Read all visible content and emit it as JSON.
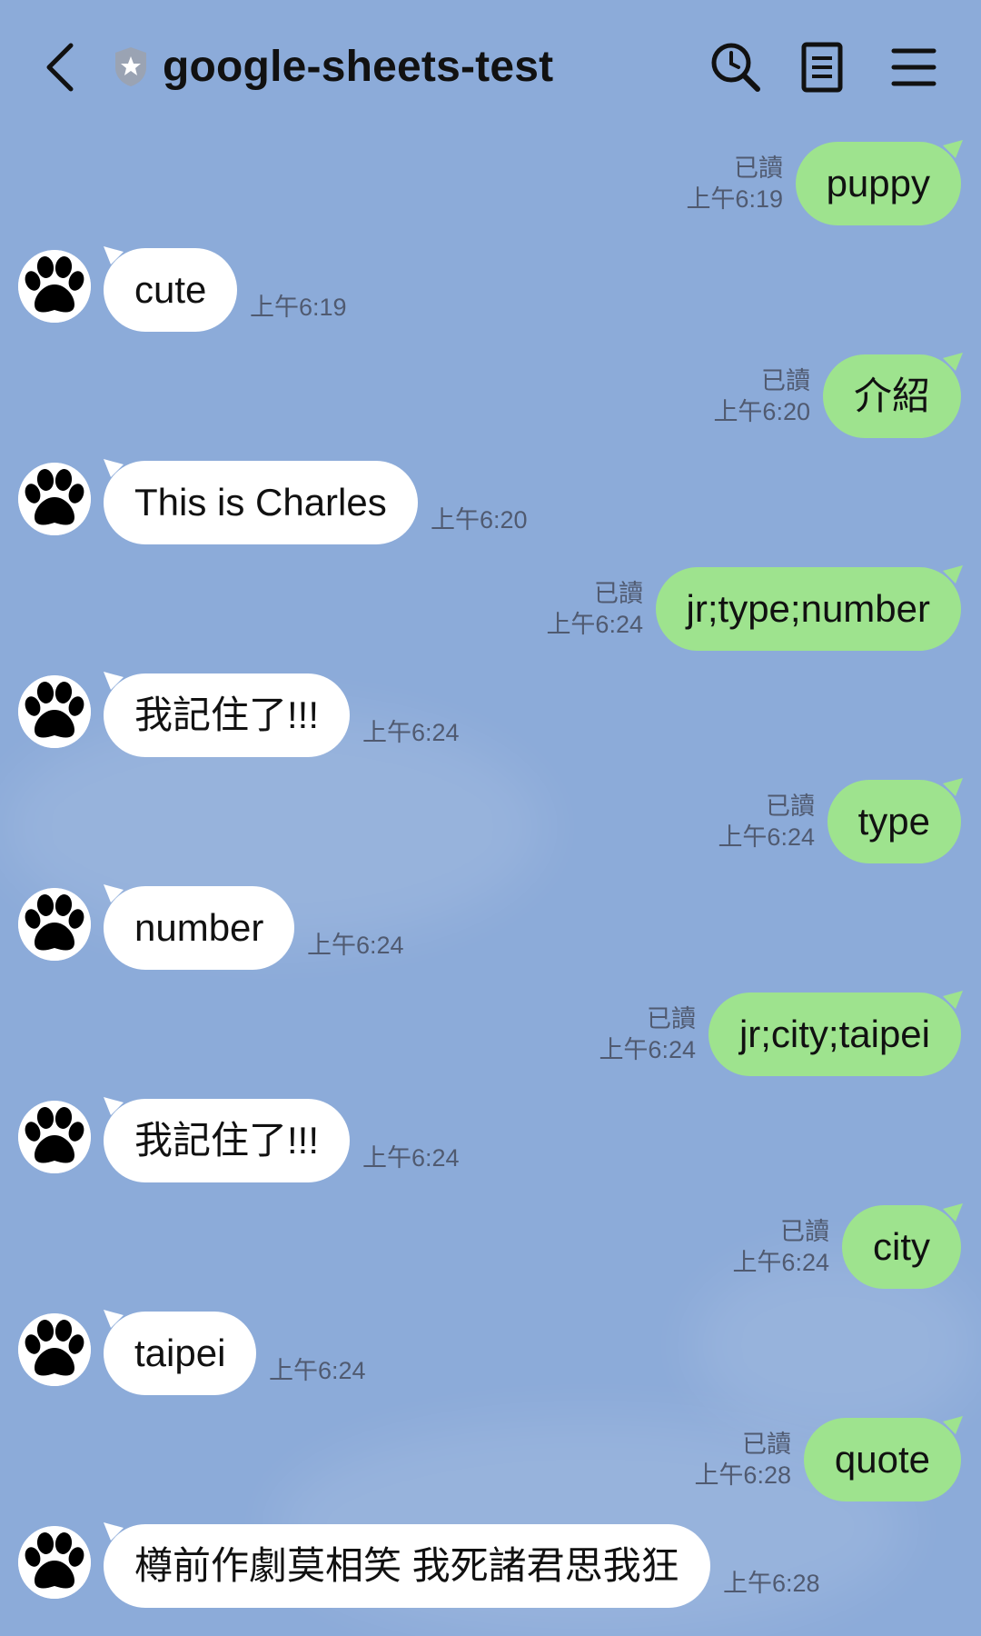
{
  "header": {
    "title": "google-sheets-test"
  },
  "colors": {
    "background": "#8CABD9",
    "outgoing_bubble": "#9EE38E",
    "incoming_bubble": "#FFFFFF"
  },
  "icons": {
    "back": "back-chevron-icon",
    "shield": "shield-star-icon",
    "search": "search-clock-icon",
    "notes": "notes-icon",
    "menu": "hamburger-menu-icon",
    "avatar": "paw-print-icon"
  },
  "messages": [
    {
      "dir": "out",
      "text": "puppy",
      "read": "已讀",
      "time": "上午6:19"
    },
    {
      "dir": "in",
      "text": "cute",
      "time": "上午6:19"
    },
    {
      "dir": "out",
      "text": "介紹",
      "read": "已讀",
      "time": "上午6:20"
    },
    {
      "dir": "in",
      "text": "This is Charles",
      "time": "上午6:20"
    },
    {
      "dir": "out",
      "text": "jr;type;number",
      "read": "已讀",
      "time": "上午6:24"
    },
    {
      "dir": "in",
      "text": "我記住了!!!",
      "time": "上午6:24"
    },
    {
      "dir": "out",
      "text": "type",
      "read": "已讀",
      "time": "上午6:24"
    },
    {
      "dir": "in",
      "text": "number",
      "time": "上午6:24"
    },
    {
      "dir": "out",
      "text": "jr;city;taipei",
      "read": "已讀",
      "time": "上午6:24"
    },
    {
      "dir": "in",
      "text": "我記住了!!!",
      "time": "上午6:24"
    },
    {
      "dir": "out",
      "text": "city",
      "read": "已讀",
      "time": "上午6:24"
    },
    {
      "dir": "in",
      "text": "taipei",
      "time": "上午6:24"
    },
    {
      "dir": "out",
      "text": "quote",
      "read": "已讀",
      "time": "上午6:28"
    },
    {
      "dir": "in",
      "text": "樽前作劇莫相笑 我死諸君思我狂",
      "time": "上午6:28"
    }
  ]
}
